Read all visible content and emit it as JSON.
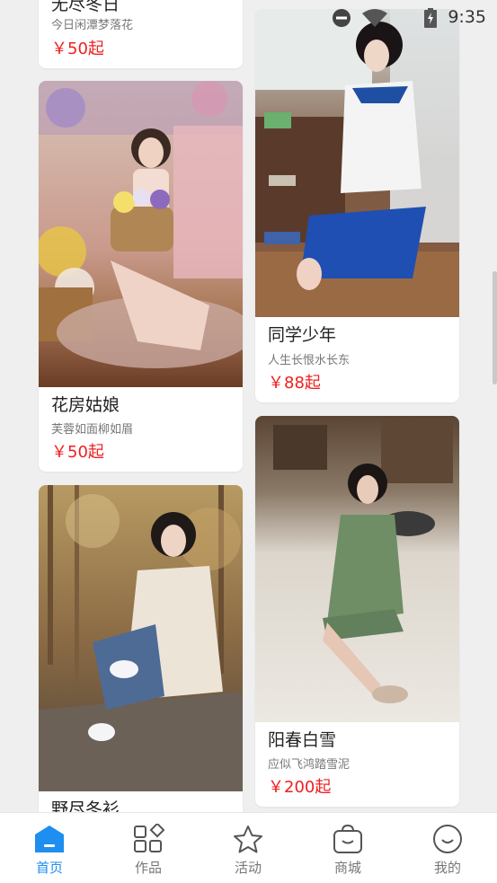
{
  "status_bar": {
    "time": "9:35"
  },
  "cards": [
    {
      "title": "无尽冬日",
      "subtitle": "今日闲潭梦落花",
      "price": "￥50起"
    },
    {
      "title": "花房姑娘",
      "subtitle": "芙蓉如面柳如眉",
      "price": "￥50起"
    },
    {
      "title": "野尽冬衫",
      "subtitle": "",
      "price": ""
    },
    {
      "title": "同学少年",
      "subtitle": "人生长恨水长东",
      "price": "￥88起"
    },
    {
      "title": "阳春白雪",
      "subtitle": "应似飞鸿踏雪泥",
      "price": "￥200起"
    }
  ],
  "tabs": [
    {
      "label": "首页",
      "icon": "home-icon",
      "active": true
    },
    {
      "label": "作品",
      "icon": "grid-icon",
      "active": false
    },
    {
      "label": "活动",
      "icon": "star-icon",
      "active": false
    },
    {
      "label": "商城",
      "icon": "shop-bag-icon",
      "active": false
    },
    {
      "label": "我的",
      "icon": "smile-face-icon",
      "active": false
    }
  ],
  "colors": {
    "price": "#ee1f1f",
    "accent": "#1e8ef0",
    "background": "#efefef"
  }
}
